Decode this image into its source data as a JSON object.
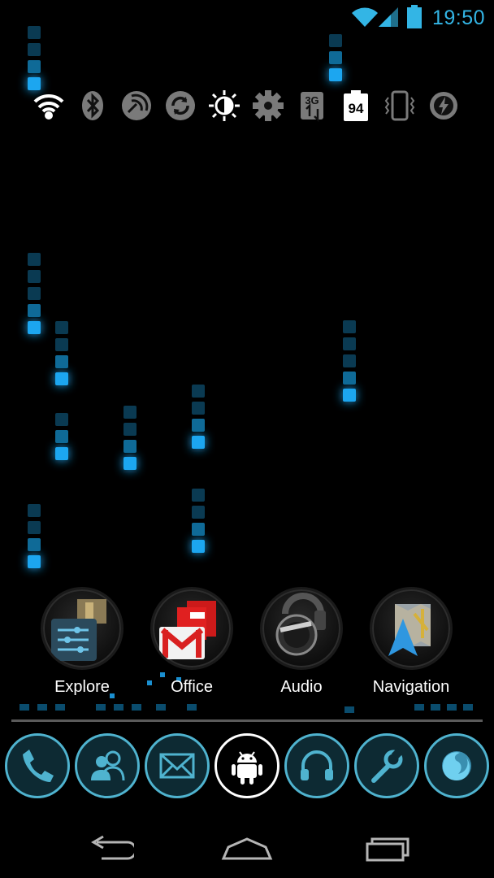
{
  "status_bar": {
    "time": "19:50",
    "icons": [
      "wifi-signal-icon",
      "cell-signal-icon",
      "battery-icon"
    ],
    "accent_color": "#33b5e5"
  },
  "quick_settings": [
    {
      "name": "wifi-toggle",
      "icon": "wifi-icon",
      "active": true
    },
    {
      "name": "bluetooth-toggle",
      "icon": "bluetooth-icon",
      "active": false
    },
    {
      "name": "gps-toggle",
      "icon": "gps-icon",
      "active": false
    },
    {
      "name": "sync-toggle",
      "icon": "sync-icon",
      "active": false
    },
    {
      "name": "brightness-toggle",
      "icon": "brightness-icon",
      "active": true
    },
    {
      "name": "settings-toggle",
      "icon": "gear-icon",
      "active": false
    },
    {
      "name": "mobile-data-toggle",
      "icon": "mobile-data-3g-icon",
      "label": "3G",
      "active": false
    },
    {
      "name": "battery-toggle",
      "icon": "battery-level-icon",
      "label": "94",
      "active": true
    },
    {
      "name": "vibrate-toggle",
      "icon": "vibrate-icon",
      "active": false
    },
    {
      "name": "power-saver-toggle",
      "icon": "power-saver-icon",
      "active": false
    }
  ],
  "folders": [
    {
      "name": "explore-folder",
      "label": "Explore"
    },
    {
      "name": "office-folder",
      "label": "Office"
    },
    {
      "name": "audio-folder",
      "label": "Audio"
    },
    {
      "name": "navigation-folder",
      "label": "Navigation"
    }
  ],
  "dock": [
    {
      "name": "phone-button",
      "icon": "phone-icon",
      "active": false
    },
    {
      "name": "contacts-button",
      "icon": "contacts-icon",
      "active": false
    },
    {
      "name": "messaging-button",
      "icon": "mail-icon",
      "active": false
    },
    {
      "name": "app-drawer-button",
      "icon": "android-icon",
      "active": true
    },
    {
      "name": "music-button",
      "icon": "headphones-icon",
      "active": false
    },
    {
      "name": "settings-button",
      "icon": "wrench-icon",
      "active": false
    },
    {
      "name": "browser-button",
      "icon": "firefox-icon",
      "active": false
    }
  ],
  "nav_bar": [
    "back-button",
    "home-button",
    "recent-apps-button"
  ],
  "colors": {
    "accent": "#33b5e5",
    "dock_ring": "#4fb3cf",
    "background": "#000000"
  }
}
